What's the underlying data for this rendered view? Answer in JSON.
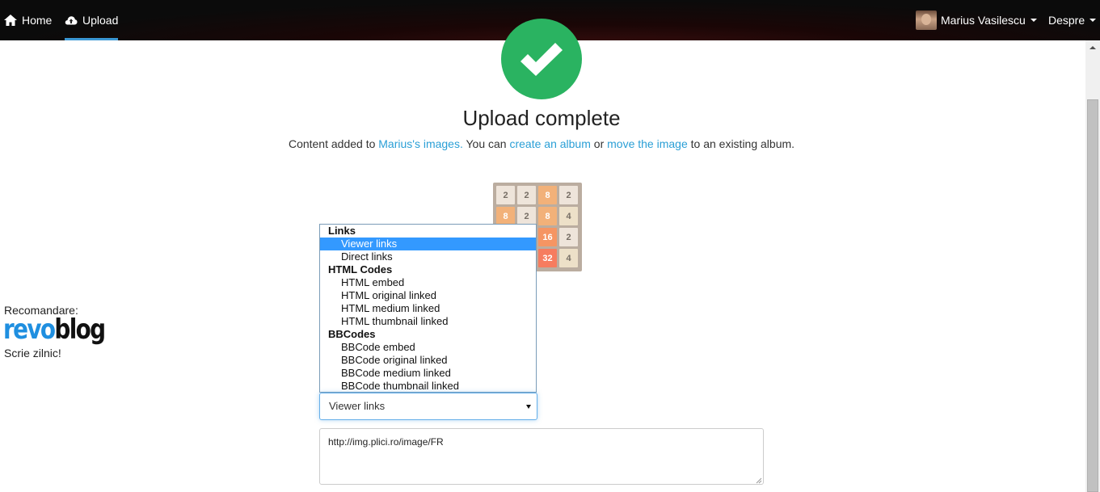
{
  "nav": {
    "home_label": "Home",
    "upload_label": "Upload",
    "user_name": "Marius Vasilescu",
    "about_label": "Despre"
  },
  "status": {
    "title": "Upload complete",
    "text_1": "Content added to ",
    "link_images": "Marius's images.",
    "text_2": " You can ",
    "link_album": "create an album",
    "text_3": " or ",
    "link_move": "move the image",
    "text_4": " to an existing album."
  },
  "promo": {
    "label": "Recomandare:",
    "logo_part1": "revo",
    "logo_part2": "blog",
    "tagline": "Scrie zilnic!"
  },
  "thumbnail": {
    "tiles": [
      {
        "row": 0,
        "col": 0,
        "value": "2"
      },
      {
        "row": 0,
        "col": 1,
        "value": "2"
      },
      {
        "row": 0,
        "col": 2,
        "value": "8"
      },
      {
        "row": 0,
        "col": 3,
        "value": "2"
      },
      {
        "row": 1,
        "col": 0,
        "value": "8"
      },
      {
        "row": 1,
        "col": 1,
        "value": "2"
      },
      {
        "row": 1,
        "col": 2,
        "value": "8"
      },
      {
        "row": 1,
        "col": 3,
        "value": "4"
      },
      {
        "row": 2,
        "col": 2,
        "value": "16"
      },
      {
        "row": 2,
        "col": 3,
        "value": "2"
      },
      {
        "row": 3,
        "col": 2,
        "value": "32"
      },
      {
        "row": 3,
        "col": 3,
        "value": "4"
      }
    ]
  },
  "embed_menu": {
    "groups": [
      {
        "label": "Links",
        "options": [
          "Viewer links",
          "Direct links"
        ]
      },
      {
        "label": "HTML Codes",
        "options": [
          "HTML embed",
          "HTML original linked",
          "HTML medium linked",
          "HTML thumbnail linked"
        ]
      },
      {
        "label": "BBCodes",
        "options": [
          "BBCode embed",
          "BBCode original linked",
          "BBCode medium linked",
          "BBCode thumbnail linked"
        ]
      }
    ],
    "selected": "Viewer links"
  },
  "embed_code": {
    "value": "http://img.plici.ro/image/FR"
  },
  "colors": {
    "accent": "#3b97d3",
    "link": "#2a9fd6",
    "success": "#2ab361"
  }
}
